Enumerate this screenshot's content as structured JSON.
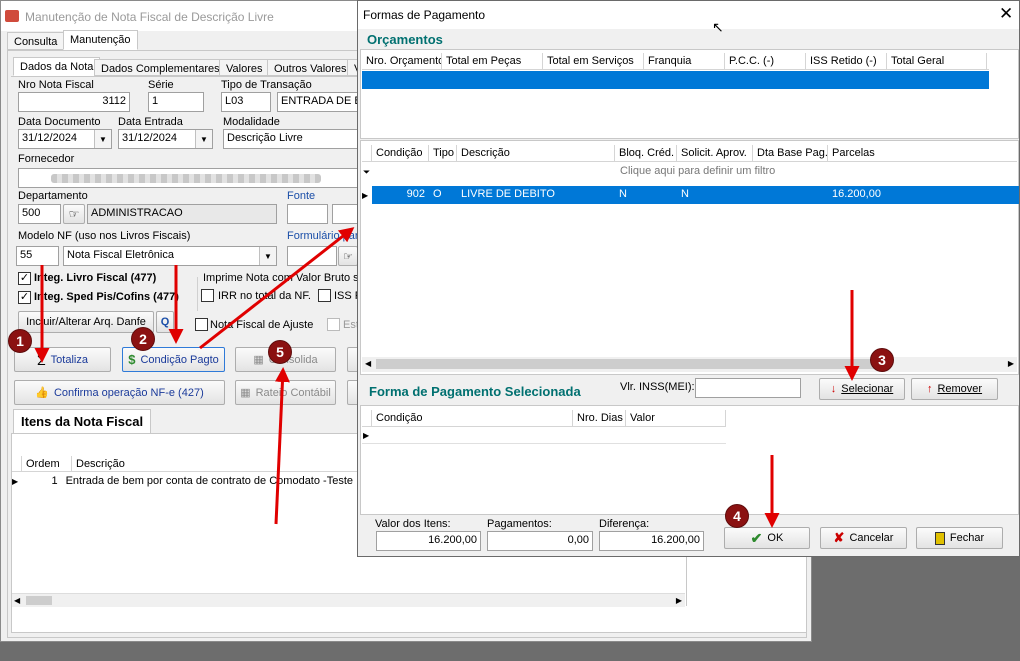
{
  "main": {
    "title": "Manutenção de Nota Fiscal de Descrição Livre",
    "top_tabs": [
      "Consulta",
      "Manutenção"
    ],
    "sub_tabs": [
      "Dados da Nota",
      "Dados Complementares",
      "Valores",
      "Outros Valores",
      "V"
    ],
    "labels": {
      "nro_nota": "Nro Nota Fiscal",
      "serie": "Série",
      "tipo_transacao": "Tipo de Transação",
      "data_documento": "Data Documento",
      "data_entrada": "Data Entrada",
      "modalidade": "Modalidade",
      "fornecedor": "Fornecedor",
      "departamento": "Departamento",
      "fonte": "Fonte",
      "modelo_nf": "Modelo NF (uso nos Livros Fiscais)",
      "formulario": "Formulário para"
    },
    "values": {
      "nro_nota": "3112",
      "serie": "1",
      "tipo_codigo": "L03",
      "tipo_desc": "ENTRADA DE BE",
      "data_documento": "31/12/2024",
      "data_entrada": "31/12/2024",
      "modalidade": "Descrição Livre",
      "departamento_cod": "500",
      "departamento_desc": "ADMINISTRACAO",
      "modelo_cod": "55",
      "modelo_desc": "Nota Fiscal Eletrônica"
    },
    "checks": {
      "integ_livro": "Integ. Livro Fiscal (477)",
      "integ_sped": "Integ. Sped Pis/Cofins (477)",
      "imprime": "Imprime Nota com Valor Bruto so",
      "irr": "IRR no total da NF.",
      "iss": "ISS R",
      "ajuste": "Nota Fiscal de Ajuste",
      "est": "Est"
    },
    "buttons": {
      "incluir": "Incluir/Alterar Arq. Danfe",
      "totaliza": "Totaliza",
      "condicao": "Condição Pagto",
      "consolida": "Consolida",
      "confirma": "Confirma operação NF-e (427)",
      "rateio": "Rateio Contábil"
    },
    "itens_title": "Itens da Nota Fiscal",
    "itens_cols": [
      "Ordem",
      "Descrição"
    ],
    "itens_rows": [
      {
        "ordem": "1",
        "descricao": "Entrada de bem por conta de contrato de Comodato -Teste"
      }
    ]
  },
  "dialog": {
    "title": "Formas de Pagamento",
    "orcamentos_title": "Orçamentos",
    "orc_cols": [
      "Nro. Orçamento",
      "Total em Peças",
      "Total em Serviços",
      "Franquia",
      "P.C.C. (-)",
      "ISS Retido (-)",
      "Total Geral"
    ],
    "cond_cols": [
      "Condição",
      "Tipo",
      "Descrição",
      "Bloq. Créd.",
      "Solicit. Aprov.",
      "Dta Base Pag.",
      "Parcelas"
    ],
    "filter_hint": "Clique aqui para definir um filtro",
    "cond_rows": [
      {
        "condicao": "902",
        "tipo": "O",
        "descricao": "LIVRE DE DEBITO",
        "bloq": "N",
        "solicit": "N",
        "dta": "",
        "parcelas": "16.200,00"
      }
    ],
    "forma_title": "Forma de Pagamento Selecionada",
    "vlr_inss_label": "Vlr. INSS(MEI):",
    "selecionar": "Selecionar",
    "remover": "Remover",
    "sel_cols": [
      "Condição",
      "Nro. Dias",
      "Valor"
    ],
    "valor_itens_label": "Valor dos Itens:",
    "valor_itens": "16.200,00",
    "pagamentos_label": "Pagamentos:",
    "pagamentos": "0,00",
    "diferenca_label": "Diferença:",
    "diferenca": "16.200,00",
    "ok": "OK",
    "cancelar": "Cancelar",
    "fechar": "Fechar"
  },
  "annotations": [
    "1",
    "2",
    "3",
    "4",
    "5"
  ],
  "colors": {
    "selection": "#0078d7",
    "section_title": "#007070",
    "marker": "#8b1111",
    "arrow": "#e00000"
  }
}
